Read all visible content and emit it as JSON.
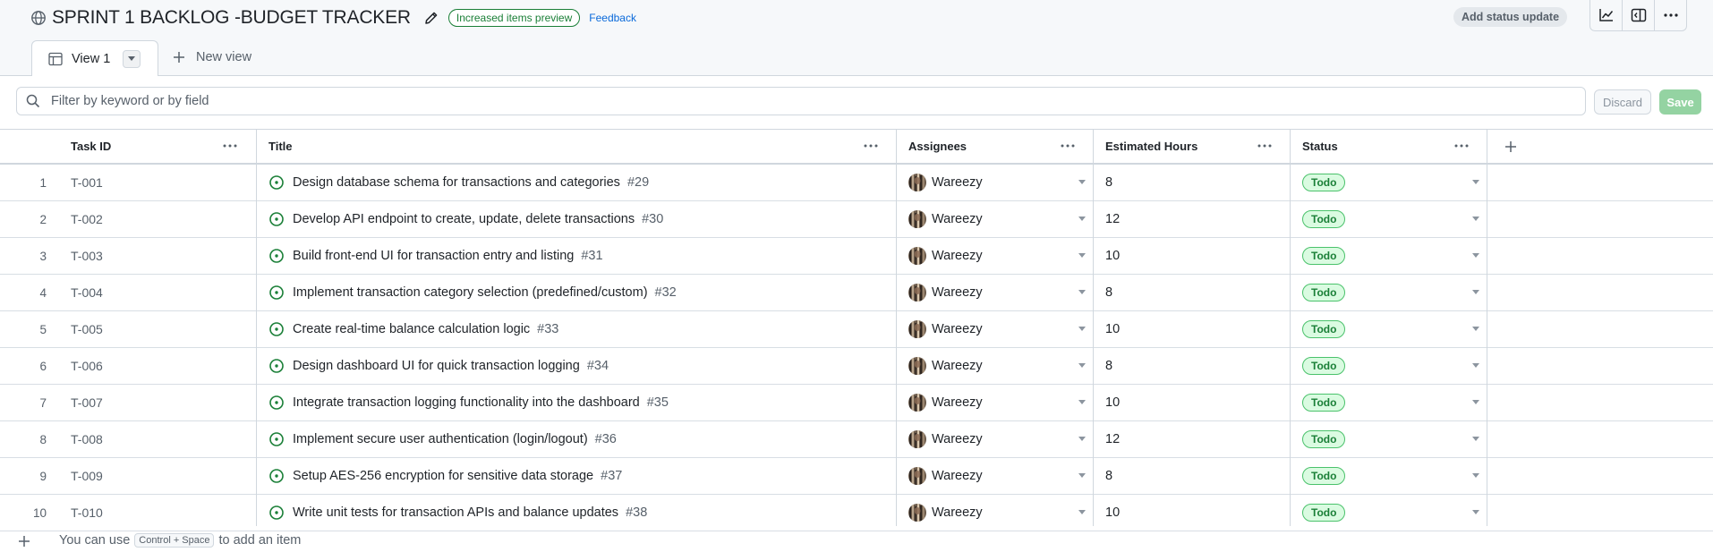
{
  "header": {
    "title": "SPRINT 1 BACKLOG -BUDGET TRACKER",
    "preview_badge": "Increased items preview",
    "feedback": "Feedback",
    "status_button": "Add status update",
    "icons": [
      "globe-icon",
      "pencil-icon",
      "insights-icon",
      "side-panel-icon",
      "kebab-icon"
    ]
  },
  "tabs": {
    "active": "View 1",
    "new_view": "New view"
  },
  "filter": {
    "placeholder": "Filter by keyword or by field",
    "discard": "Discard",
    "save": "Save"
  },
  "columns": {
    "task_id": "Task ID",
    "title": "Title",
    "assignees": "Assignees",
    "hours": "Estimated Hours",
    "status": "Status"
  },
  "rows": [
    {
      "n": "1",
      "id": "T-001",
      "title": "Design database schema for transactions and categories",
      "num": "#29",
      "assignee": "Wareezy",
      "hours": "8",
      "status": "Todo"
    },
    {
      "n": "2",
      "id": "T-002",
      "title": "Develop API endpoint to create, update, delete transactions",
      "num": "#30",
      "assignee": "Wareezy",
      "hours": "12",
      "status": "Todo"
    },
    {
      "n": "3",
      "id": "T-003",
      "title": "Build front-end UI for transaction entry and listing",
      "num": "#31",
      "assignee": "Wareezy",
      "hours": "10",
      "status": "Todo"
    },
    {
      "n": "4",
      "id": "T-004",
      "title": "Implement transaction category selection (predefined/custom)",
      "num": "#32",
      "assignee": "Wareezy",
      "hours": "8",
      "status": "Todo"
    },
    {
      "n": "5",
      "id": "T-005",
      "title": "Create real-time balance calculation logic",
      "num": "#33",
      "assignee": "Wareezy",
      "hours": "10",
      "status": "Todo"
    },
    {
      "n": "6",
      "id": "T-006",
      "title": "Design dashboard UI for quick transaction logging",
      "num": "#34",
      "assignee": "Wareezy",
      "hours": "8",
      "status": "Todo"
    },
    {
      "n": "7",
      "id": "T-007",
      "title": "Integrate transaction logging functionality into the dashboard",
      "num": "#35",
      "assignee": "Wareezy",
      "hours": "10",
      "status": "Todo"
    },
    {
      "n": "8",
      "id": "T-008",
      "title": "Implement secure user authentication (login/logout)",
      "num": "#36",
      "assignee": "Wareezy",
      "hours": "12",
      "status": "Todo"
    },
    {
      "n": "9",
      "id": "T-009",
      "title": "Setup AES-256 encryption for sensitive data storage",
      "num": "#37",
      "assignee": "Wareezy",
      "hours": "8",
      "status": "Todo"
    },
    {
      "n": "10",
      "id": "T-010",
      "title": "Write unit tests for transaction APIs and balance updates",
      "num": "#38",
      "assignee": "Wareezy",
      "hours": "10",
      "status": "Todo"
    }
  ],
  "footer": {
    "prefix": "You can use",
    "shortcut": "Control + Space",
    "suffix": "to add an item"
  },
  "colors": {
    "accent_green": "#1a7f37",
    "status_bg": "#dafbe1",
    "link_blue": "#0969da"
  }
}
